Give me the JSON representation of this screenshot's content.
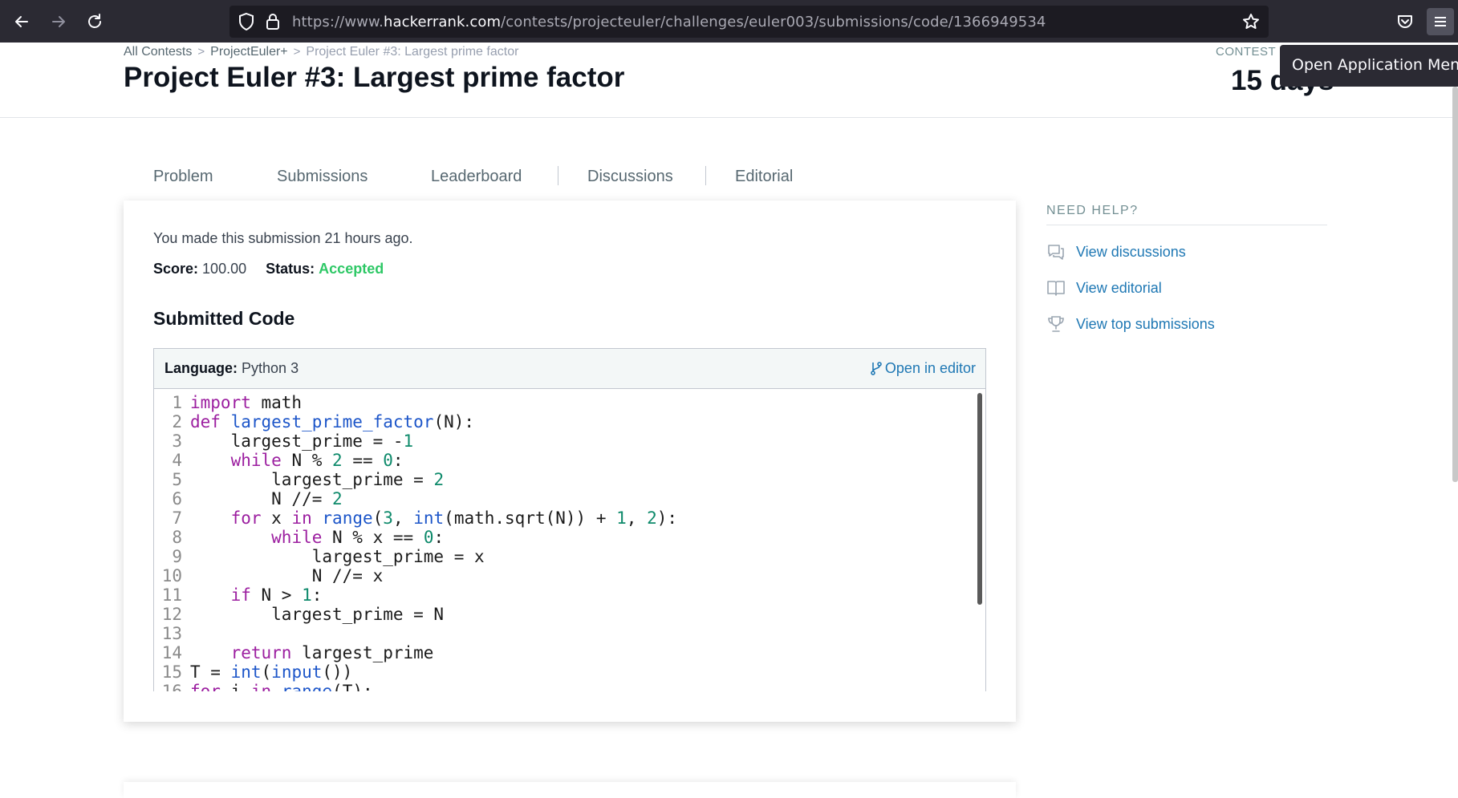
{
  "browser": {
    "url_prefix": "https://www.",
    "url_host": "hackerrank.com",
    "url_path": "/contests/projecteuler/challenges/euler003/submissions/code/1366949534",
    "tooltip": "Open Application Menu"
  },
  "breadcrumb": {
    "items": [
      "All Contests",
      "ProjectEuler+",
      "Project Euler #3: Largest prime factor"
    ]
  },
  "page": {
    "title": "Project Euler #3: Largest prime factor",
    "contest_ends_label": "CONTEST ENDS IN",
    "contest_ends_value": "15 days"
  },
  "tabs": [
    "Problem",
    "Submissions",
    "Leaderboard",
    "Discussions",
    "Editorial"
  ],
  "active_tab": "Submissions",
  "submission": {
    "note": "You made this submission 21 hours ago.",
    "score_label": "Score:",
    "score_value": "100.00",
    "status_label": "Status:",
    "status_value": "Accepted",
    "section_title": "Submitted Code",
    "language_label": "Language:",
    "language_value": "Python 3",
    "open_editor_label": "Open in editor"
  },
  "code_lines": [
    "import math",
    "def largest_prime_factor(N):",
    "    largest_prime = -1",
    "    while N % 2 == 0:",
    "        largest_prime = 2",
    "        N //= 2",
    "    for x in range(3, int(math.sqrt(N)) + 1, 2):",
    "        while N % x == 0:",
    "            largest_prime = x",
    "            N //= x",
    "    if N > 1:",
    "        largest_prime = N",
    "",
    "    return largest_prime",
    "T = int(input())",
    "for i in range(T):"
  ],
  "sidebar": {
    "heading": "NEED HELP?",
    "links": [
      {
        "label": "View discussions",
        "icon": "discussions-icon"
      },
      {
        "label": "View editorial",
        "icon": "book-icon"
      },
      {
        "label": "View top submissions",
        "icon": "trophy-icon"
      }
    ]
  },
  "colors": {
    "accepted": "#2ec866",
    "link": "#1f78b4",
    "keyword": "#9c1fa0",
    "function": "#1d56c9",
    "number": "#0e8a6b"
  }
}
